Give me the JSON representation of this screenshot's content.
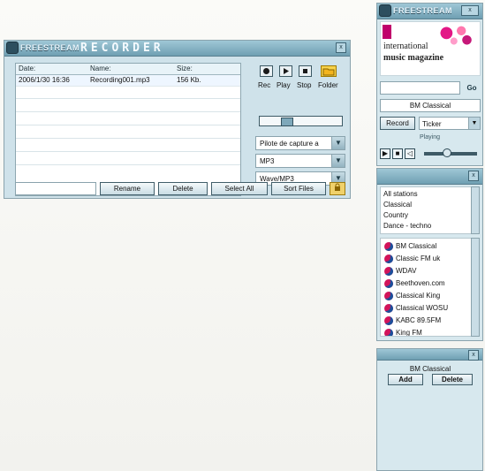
{
  "recorder": {
    "logo_text": "FREESTREAM",
    "title": "RECORDER",
    "close_label": "x",
    "columns": [
      "Date:",
      "Name:",
      "Size:"
    ],
    "rows": [
      {
        "date": "2006/1/30 16:36",
        "name": "Recording001.mp3",
        "size": "156 Kb."
      }
    ],
    "controls": {
      "rec": "Rec",
      "play": "Play",
      "stop": "Stop",
      "folder": "Folder"
    },
    "slider_value": 0.3,
    "selects": [
      {
        "value": "Pilote de capture a"
      },
      {
        "value": "MP3"
      },
      {
        "value": "Wave/MP3"
      }
    ],
    "buttons": {
      "rename": "Rename",
      "delete": "Delete",
      "select_all": "Select All",
      "sort_files": "Sort Files"
    }
  },
  "player": {
    "logo_text": "FREESTREAM",
    "ad": {
      "line1": "international",
      "line2": "music magazine"
    },
    "go_label": "Go",
    "station": "BM Classical",
    "record_label": "Record",
    "ticker_label": "Ticker",
    "playing_label": "Playing",
    "volume_value": 0.55
  },
  "stations_panel": {
    "genres": [
      "All stations",
      "Classical",
      "Country",
      "Dance - techno"
    ],
    "stations": [
      "BM Classical",
      "Classic FM uk",
      "WDAV",
      "Beethoven.com",
      "Classical King",
      "Classical WOSU",
      "KABC 89.5FM",
      "King FM"
    ]
  },
  "favorites": {
    "title": "BM Classical",
    "add": "Add",
    "delete": "Delete"
  },
  "colors": {
    "window_bg": "#cfe2ea",
    "titlebar": "#6f9fb2",
    "accent_pink": "#d2145a"
  }
}
